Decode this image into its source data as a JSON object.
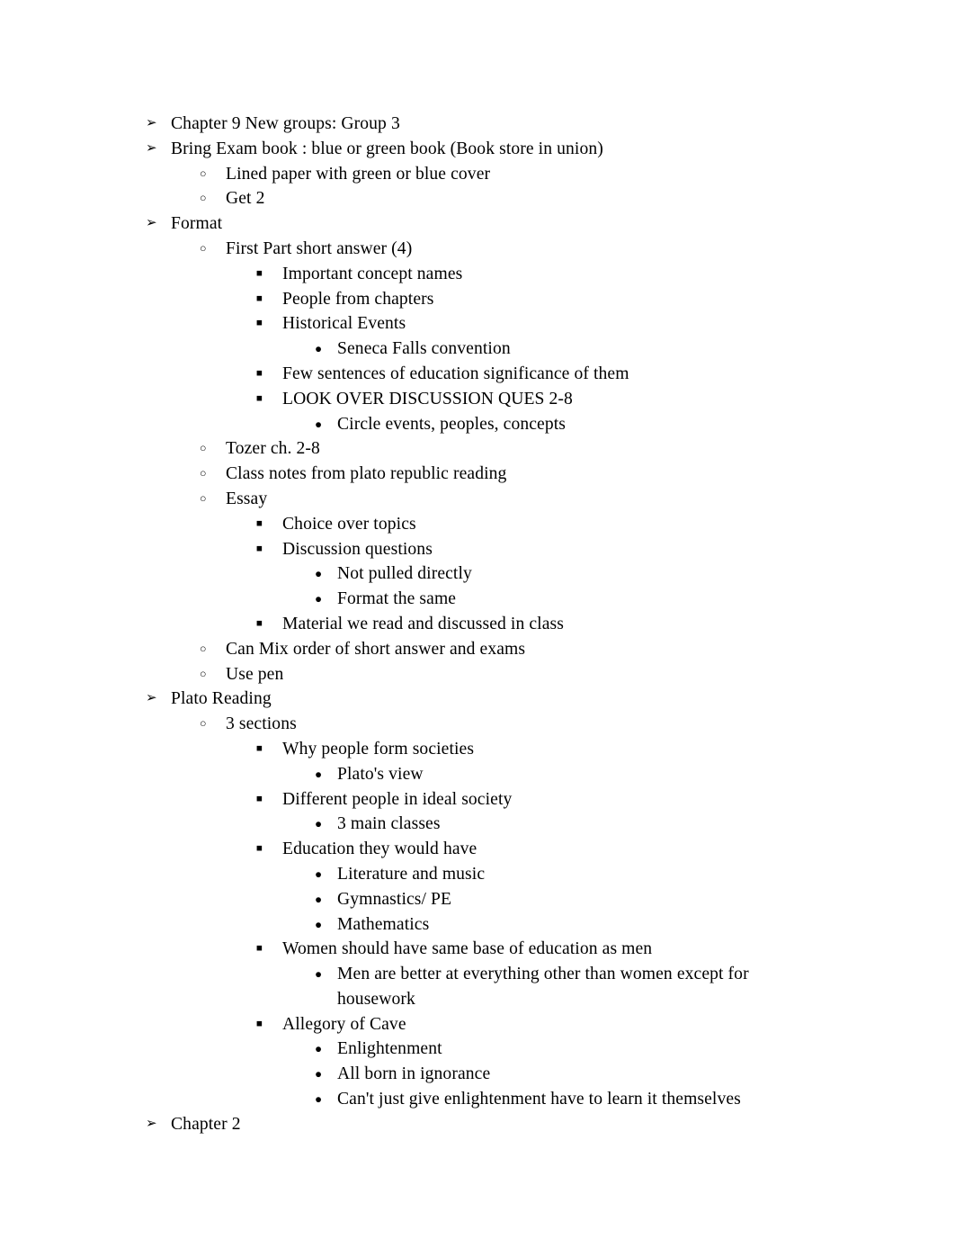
{
  "document": {
    "background_color": "#ffffff",
    "text_color": "#000000",
    "markers": {
      "level1": "➢",
      "level2": "○",
      "level3": "■",
      "level4": "●"
    },
    "outline": [
      {
        "level": 1,
        "text": "Chapter 9 New groups: Group 3"
      },
      {
        "level": 1,
        "text": "Bring Exam book : blue or green book (Book store in union)"
      },
      {
        "level": 2,
        "text": "Lined paper with green or blue cover"
      },
      {
        "level": 2,
        "text": "Get 2"
      },
      {
        "level": 1,
        "text": "Format"
      },
      {
        "level": 2,
        "text": "First Part short answer (4)"
      },
      {
        "level": 3,
        "text": "Important concept names"
      },
      {
        "level": 3,
        "text": "People from chapters"
      },
      {
        "level": 3,
        "text": "Historical Events"
      },
      {
        "level": 4,
        "text": "Seneca Falls convention"
      },
      {
        "level": 3,
        "text": "Few sentences of education significance of them"
      },
      {
        "level": 3,
        "text": "LOOK OVER DISCUSSION QUES 2-8"
      },
      {
        "level": 4,
        "text": "Circle events, peoples, concepts"
      },
      {
        "level": 2,
        "text": "Tozer ch. 2-8"
      },
      {
        "level": 2,
        "text": "Class notes from plato republic reading"
      },
      {
        "level": 2,
        "text": "Essay"
      },
      {
        "level": 3,
        "text": "Choice over topics"
      },
      {
        "level": 3,
        "text": "Discussion questions"
      },
      {
        "level": 4,
        "text": "Not pulled directly"
      },
      {
        "level": 4,
        "text": "Format the same"
      },
      {
        "level": 3,
        "text": "Material we read and discussed in class"
      },
      {
        "level": 2,
        "text": "Can Mix order of short answer and exams"
      },
      {
        "level": 2,
        "text": "Use pen"
      },
      {
        "level": 1,
        "text": "Plato Reading"
      },
      {
        "level": 2,
        "text": "3 sections"
      },
      {
        "level": 3,
        "text": "Why people form societies"
      },
      {
        "level": 4,
        "text": "Plato's view"
      },
      {
        "level": 3,
        "text": "Different people in ideal society"
      },
      {
        "level": 4,
        "text": "3 main classes"
      },
      {
        "level": 3,
        "text": "Education they would have"
      },
      {
        "level": 4,
        "text": "Literature and music"
      },
      {
        "level": 4,
        "text": "Gymnastics/ PE"
      },
      {
        "level": 4,
        "text": "Mathematics"
      },
      {
        "level": 3,
        "text": "Women should have same base of education as men"
      },
      {
        "level": 4,
        "text": "Men are better at everything other than women except for housework"
      },
      {
        "level": 3,
        "text": "Allegory of Cave"
      },
      {
        "level": 4,
        "text": "Enlightenment"
      },
      {
        "level": 4,
        "text": "All born in ignorance"
      },
      {
        "level": 4,
        "text": "Can't just give enlightenment have to learn it themselves"
      },
      {
        "level": 1,
        "text": "Chapter 2"
      }
    ]
  }
}
